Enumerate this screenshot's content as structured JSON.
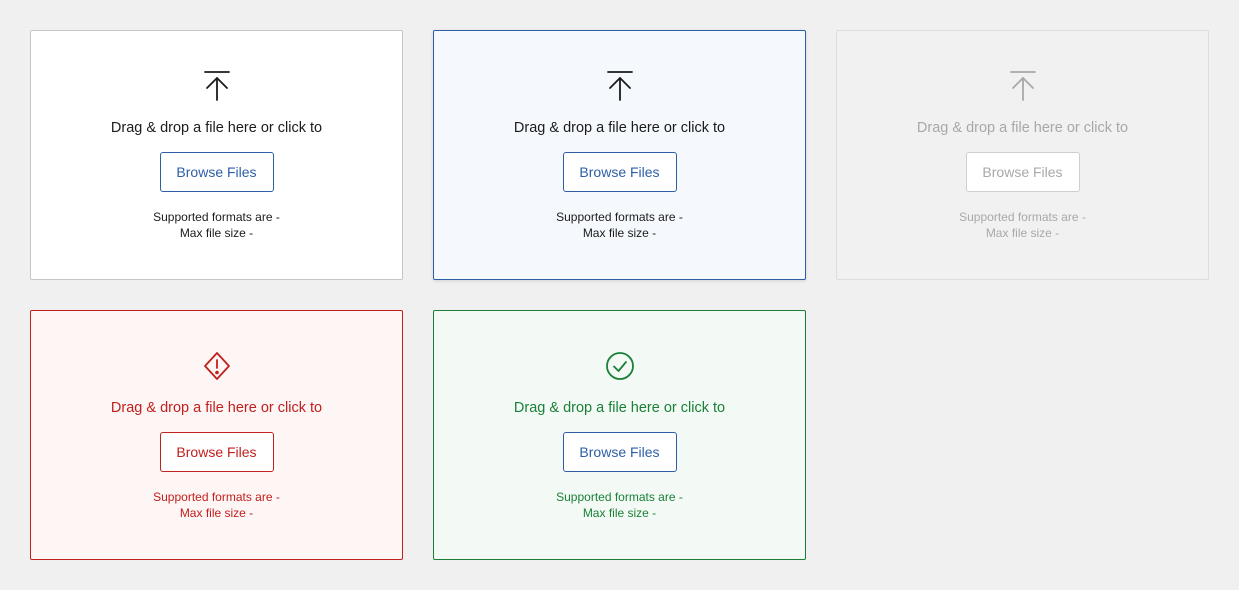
{
  "colors": {
    "page_background": "#f0f0f0",
    "primary": "#2e5ea8",
    "error": "#c0201e",
    "success": "#1a7f37",
    "disabled": "#a8a8a8",
    "text": "#1b1b1b"
  },
  "dropzones": [
    {
      "state": "default",
      "icon": "upload-icon",
      "prompt": "Drag & drop a file here or click to",
      "button_label": "Browse Files",
      "formats_label": "Supported formats are -",
      "size_label": "Max file size -"
    },
    {
      "state": "hover",
      "icon": "upload-icon",
      "prompt": "Drag & drop a file here or click to",
      "button_label": "Browse Files",
      "formats_label": "Supported formats are -",
      "size_label": "Max file size -"
    },
    {
      "state": "disabled",
      "icon": "upload-icon",
      "prompt": "Drag & drop a file here or click to",
      "button_label": "Browse Files",
      "formats_label": "Supported formats are -",
      "size_label": "Max file size -"
    },
    {
      "state": "error",
      "icon": "warning-diamond-icon",
      "prompt": "Drag & drop a file here or click to",
      "button_label": "Browse Files",
      "formats_label": "Supported formats are -",
      "size_label": "Max file size -"
    },
    {
      "state": "success",
      "icon": "check-circle-icon",
      "prompt": "Drag & drop a file here or click to",
      "button_label": "Browse Files",
      "formats_label": "Supported formats are -",
      "size_label": "Max file size -"
    }
  ]
}
